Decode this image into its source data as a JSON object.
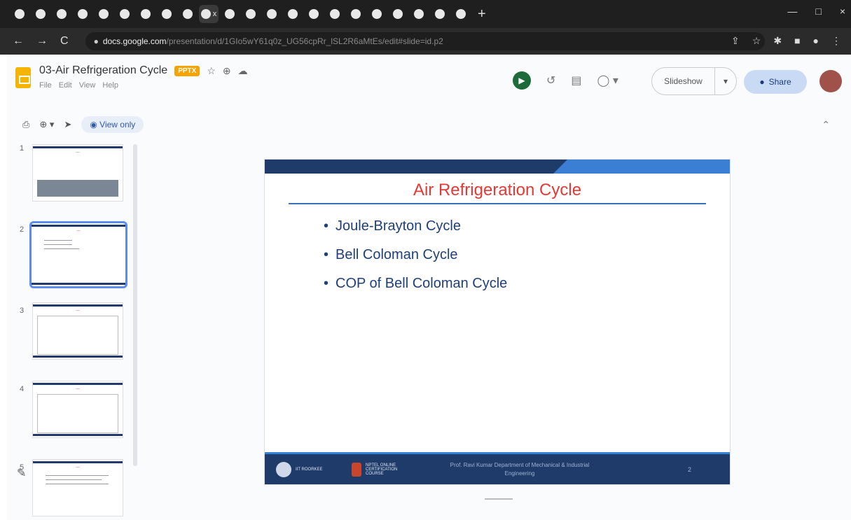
{
  "browser": {
    "tabs_count": 22,
    "new_tab_label": "+",
    "close_mark": "x",
    "url_host": "docs.google.com",
    "url_path": "/presentation/d/1GIo5wY61q0z_UG56cpRr_lSL2R6aMtEs/edit#slide=id.p2",
    "window_controls": [
      "—",
      "□",
      "×"
    ]
  },
  "app": {
    "doc_title": "03-Air Refrigeration Cycle",
    "badge": "PPTX",
    "menu": [
      "File",
      "Edit",
      "View",
      "Help"
    ],
    "view_only_label": "View only",
    "slideshow_label": "Slideshow",
    "share_label": "Share"
  },
  "filmstrip": {
    "numbers": [
      "1",
      "2",
      "3",
      "4",
      "5"
    ],
    "selected": 2
  },
  "slide": {
    "title": "Air Refrigeration Cycle",
    "bullets": [
      "Joule-Brayton Cycle",
      "Bell Coloman Cycle",
      "COP of Bell Coloman Cycle"
    ],
    "footer_text": "Prof. Ravi Kumar Department of Mechanical & Industrial Engineering",
    "footer_org1": "IIT ROORKEE",
    "footer_org2": "NPTEL ONLINE CERTIFICATION COURSE",
    "page_number": "2"
  },
  "colors": {
    "slide_title": "#e53935",
    "bullet_text": "#1e3f7a",
    "slide_band": "#1f3b6a",
    "accent_blue": "#3b7fd4"
  }
}
